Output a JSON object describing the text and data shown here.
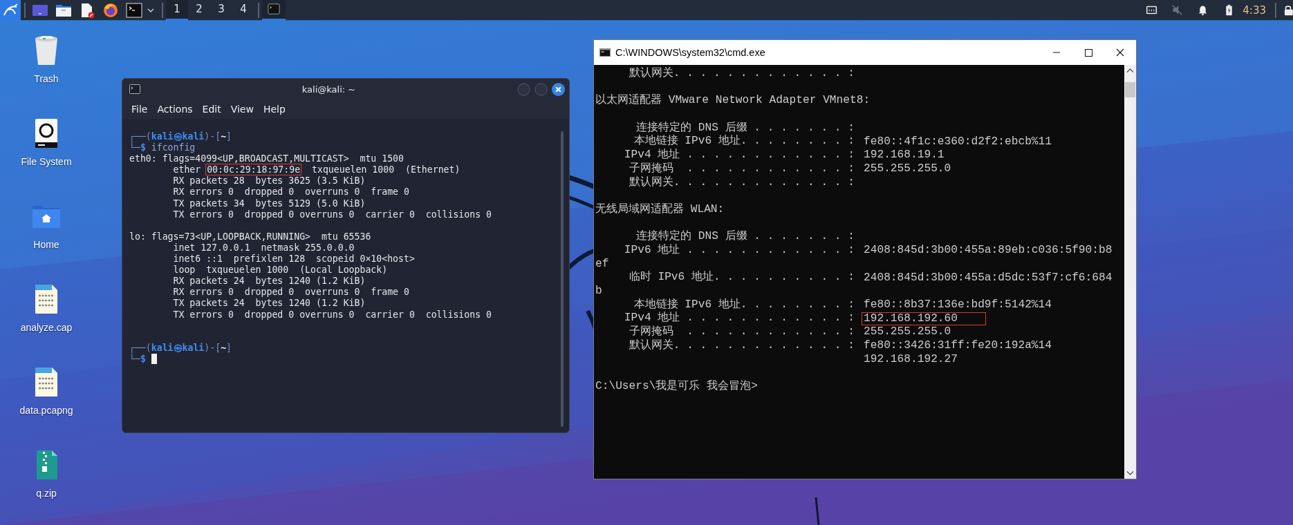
{
  "taskbar": {
    "workspaces": [
      {
        "label": "1",
        "selected": true
      },
      {
        "label": "2",
        "selected": false
      },
      {
        "label": "3",
        "selected": false
      },
      {
        "label": "4",
        "selected": false
      }
    ],
    "task": {
      "selected": true
    },
    "clock": "4:33"
  },
  "desktop_icons": [
    {
      "label": "Trash",
      "kind": "trash"
    },
    {
      "label": "File System",
      "kind": "drive"
    },
    {
      "label": "Home",
      "kind": "home"
    },
    {
      "label": "analyze.cap",
      "kind": "binary"
    },
    {
      "label": "data.pcapng",
      "kind": "binary"
    },
    {
      "label": "q.zip",
      "kind": "archive"
    }
  ],
  "terminal": {
    "title": "kali@kali: ~",
    "menu": [
      "File",
      "Actions",
      "Edit",
      "View",
      "Help"
    ],
    "lines": [
      {
        "kind": "text",
        "segments": [
          {
            "kind": "frame",
            "text": "┌──("
          },
          {
            "kind": "user",
            "text": "kali㉿kali"
          },
          {
            "kind": "frame",
            "text": ")-["
          },
          {
            "kind": "dir",
            "text": "~"
          },
          {
            "kind": "frame",
            "text": "]"
          }
        ]
      },
      {
        "kind": "text",
        "segments": [
          {
            "kind": "frame",
            "text": "└─"
          },
          {
            "kind": "user",
            "text": "$"
          },
          {
            "kind": "command",
            "text": " ifconfig"
          }
        ]
      },
      {
        "kind": "text",
        "segments": [
          {
            "kind": "plain",
            "text": "eth0: flags=4099<UP,BROADCAST,MULTICAST>  mtu 1500"
          }
        ]
      },
      {
        "kind": "text",
        "segments": [
          {
            "kind": "plain",
            "text": "        ether "
          },
          {
            "kind": "boxed",
            "text": "00:0c:29:18:97:9e"
          },
          {
            "kind": "plain",
            "text": "  txqueuelen 1000  (Ethernet)"
          }
        ]
      },
      {
        "kind": "text",
        "segments": [
          {
            "kind": "plain",
            "text": "        RX packets 28  bytes 3625 (3.5 KiB)"
          }
        ]
      },
      {
        "kind": "text",
        "segments": [
          {
            "kind": "plain",
            "text": "        RX errors 0  dropped 0  overruns 0  frame 0"
          }
        ]
      },
      {
        "kind": "text",
        "segments": [
          {
            "kind": "plain",
            "text": "        TX packets 34  bytes 5129 (5.0 KiB)"
          }
        ]
      },
      {
        "kind": "text",
        "segments": [
          {
            "kind": "plain",
            "text": "        TX errors 0  dropped 0 overruns 0  carrier 0  collisions 0"
          }
        ]
      },
      {
        "kind": "blank"
      },
      {
        "kind": "text",
        "segments": [
          {
            "kind": "plain",
            "text": "lo: flags=73<UP,LOOPBACK,RUNNING>  mtu 65536"
          }
        ]
      },
      {
        "kind": "text",
        "segments": [
          {
            "kind": "plain",
            "text": "        inet 127.0.0.1  netmask 255.0.0.0"
          }
        ]
      },
      {
        "kind": "text",
        "segments": [
          {
            "kind": "plain",
            "text": "        inet6 ::1  prefixlen 128  scopeid 0×10<host>"
          }
        ]
      },
      {
        "kind": "text",
        "segments": [
          {
            "kind": "plain",
            "text": "        loop  txqueuelen 1000  (Local Loopback)"
          }
        ]
      },
      {
        "kind": "text",
        "segments": [
          {
            "kind": "plain",
            "text": "        RX packets 24  bytes 1240 (1.2 KiB)"
          }
        ]
      },
      {
        "kind": "text",
        "segments": [
          {
            "kind": "plain",
            "text": "        RX errors 0  dropped 0  overruns 0  frame 0"
          }
        ]
      },
      {
        "kind": "text",
        "segments": [
          {
            "kind": "plain",
            "text": "        TX packets 24  bytes 1240 (1.2 KiB)"
          }
        ]
      },
      {
        "kind": "text",
        "segments": [
          {
            "kind": "plain",
            "text": "        TX errors 0  dropped 0 overruns 0  carrier 0  collisions 0"
          }
        ]
      },
      {
        "kind": "blank"
      },
      {
        "kind": "blank"
      },
      {
        "kind": "text",
        "segments": [
          {
            "kind": "frame",
            "text": "┌──("
          },
          {
            "kind": "user",
            "text": "kali㉿kali"
          },
          {
            "kind": "frame",
            "text": ")-["
          },
          {
            "kind": "dir",
            "text": "~"
          },
          {
            "kind": "frame",
            "text": "]"
          }
        ]
      },
      {
        "kind": "text",
        "segments": [
          {
            "kind": "frame",
            "text": "└─"
          },
          {
            "kind": "user",
            "text": "$"
          },
          {
            "kind": "cursor"
          }
        ]
      }
    ]
  },
  "cmd": {
    "title": "C:\\WINDOWS\\system32\\cmd.exe",
    "lines": [
      {
        "kind": "field",
        "label": "   默认网关. . . . . . . . . . . . . :"
      },
      {
        "kind": "blank"
      },
      {
        "kind": "text",
        "text": "以太网适配器 VMware Network Adapter VMnet8:"
      },
      {
        "kind": "blank"
      },
      {
        "kind": "field",
        "label": "   连接特定的 DNS 后缀 . . . . . . . :"
      },
      {
        "kind": "field",
        "label": "   本地链接 IPv6 地址. . . . . . . . :",
        "value": "fe80::4f1c:e360:d2f2:ebcb%11",
        "boxed": false
      },
      {
        "kind": "field",
        "label": "   IPv4 地址 . . . . . . . . . . . . :",
        "value": "192.168.19.1",
        "boxed": false
      },
      {
        "kind": "field",
        "label": "   子网掩码  . . . . . . . . . . . . :",
        "value": "255.255.255.0",
        "boxed": false
      },
      {
        "kind": "field",
        "label": "   默认网关. . . . . . . . . . . . . :"
      },
      {
        "kind": "blank"
      },
      {
        "kind": "text",
        "text": "无线局域网适配器 WLAN:"
      },
      {
        "kind": "blank"
      },
      {
        "kind": "field",
        "label": "   连接特定的 DNS 后缀 . . . . . . . :"
      },
      {
        "kind": "field",
        "label": "   IPv6 地址 . . . . . . . . . . . . :",
        "value": "2408:845d:3b00:455a:89eb:c036:5f90:b8",
        "boxed": false
      },
      {
        "kind": "text",
        "text": "ef"
      },
      {
        "kind": "field",
        "label": "   临时 IPv6 地址. . . . . . . . . . :",
        "value": "2408:845d:3b00:455a:d5dc:53f7:cf6:684",
        "boxed": false
      },
      {
        "kind": "text",
        "text": "b"
      },
      {
        "kind": "field",
        "label": "   本地链接 IPv6 地址. . . . . . . . :",
        "value": "fe80::8b37:136e:bd9f:5142%14",
        "boxed": false
      },
      {
        "kind": "field",
        "label": "   IPv4 地址 . . . . . . . . . . . . :",
        "value": "192.168.192.60",
        "boxed": true
      },
      {
        "kind": "field",
        "label": "   子网掩码  . . . . . . . . . . . . :",
        "value": "255.255.255.0",
        "boxed": false
      },
      {
        "kind": "field",
        "label": "   默认网关. . . . . . . . . . . . . :",
        "value": "fe80::3426:31ff:fe20:192a%14",
        "boxed": false
      },
      {
        "kind": "value",
        "value": "192.168.192.27",
        "boxed": false
      },
      {
        "kind": "blank"
      },
      {
        "kind": "text",
        "text": "C:\\Users\\我是可乐 我会冒泡>"
      }
    ]
  }
}
